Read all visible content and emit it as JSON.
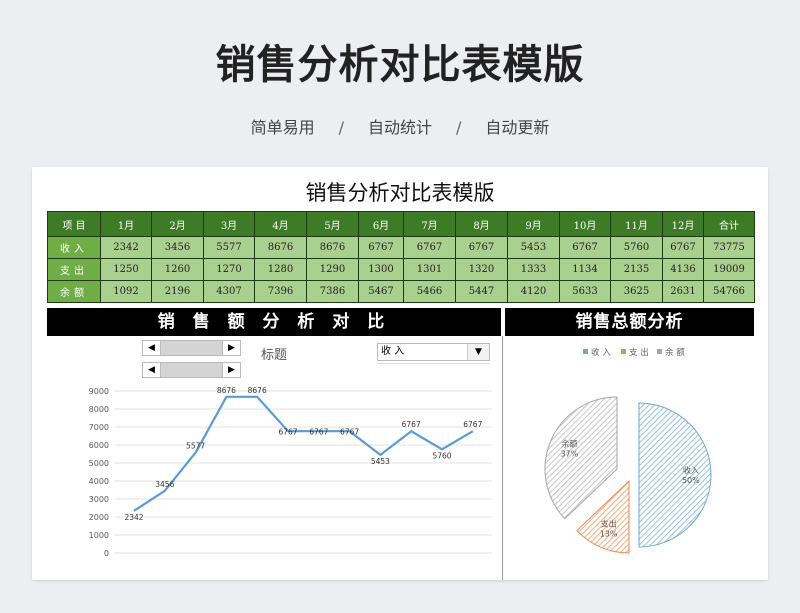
{
  "header": {
    "title": "销售分析对比表模版",
    "features": [
      "简单易用",
      "自动统计",
      "自动更新"
    ],
    "separator": "/"
  },
  "sheet": {
    "title": "销售分析对比表模版",
    "table": {
      "columns": [
        "项 目",
        "1月",
        "2月",
        "3月",
        "4月",
        "5月",
        "6月",
        "7月",
        "8月",
        "9月",
        "10月",
        "11月",
        "12月",
        "合计"
      ],
      "rows": [
        {
          "label": "收入",
          "values": [
            "2342",
            "3456",
            "5577",
            "8676",
            "8676",
            "6767",
            "6767",
            "6767",
            "5453",
            "6767",
            "5760",
            "6767",
            "73775"
          ]
        },
        {
          "label": "支出",
          "values": [
            "1250",
            "1260",
            "1270",
            "1280",
            "1290",
            "1300",
            "1301",
            "1320",
            "1333",
            "1134",
            "2135",
            "4136",
            "19009"
          ]
        },
        {
          "label": "余额",
          "values": [
            "1092",
            "2196",
            "4307",
            "7396",
            "7386",
            "5467",
            "5466",
            "5447",
            "4120",
            "5633",
            "3625",
            "2631",
            "54766"
          ]
        }
      ]
    },
    "line_panel": {
      "heading": "销 售 额 分 析 对 比",
      "chart_title": "标题",
      "selector_value": "收 入",
      "scroll_left": "◀",
      "scroll_right": "▶",
      "dropdown_arrow": "▼"
    },
    "pie_panel": {
      "heading": "销售总额分析"
    }
  },
  "colors": {
    "table_header": "#3e7b27",
    "table_label": "#70ad47",
    "table_cell": "#a9d08e",
    "line": "#5b9bd5",
    "pie_income": "#9dc3e6",
    "pie_expense": "#f4b183",
    "pie_balance": "#c9c9c9"
  },
  "chart_data": [
    {
      "type": "line",
      "title": "标题",
      "series": [
        {
          "name": "收 入",
          "x": [
            1,
            2,
            3,
            4,
            5,
            6,
            7,
            8,
            9,
            10,
            11,
            12
          ],
          "values": [
            2342,
            3456,
            5577,
            8676,
            8676,
            6767,
            6767,
            6767,
            5453,
            6767,
            5760,
            6767
          ]
        }
      ],
      "data_labels": [
        "2342",
        "3456",
        "5577",
        "8676",
        "8676",
        "6767",
        "6767",
        "6767",
        "5453",
        "6767",
        "5760",
        "6767"
      ],
      "ylim": [
        0,
        9000
      ],
      "yticks": [
        0,
        1000,
        2000,
        3000,
        4000,
        5000,
        6000,
        7000,
        8000,
        9000
      ],
      "grid": true
    },
    {
      "type": "pie",
      "title": "",
      "categories": [
        "收 入",
        "支 出",
        "余 额"
      ],
      "values": [
        73775,
        19009,
        54766
      ],
      "percent_labels": [
        "50%",
        "13%",
        "37%"
      ],
      "legend": "top"
    }
  ]
}
